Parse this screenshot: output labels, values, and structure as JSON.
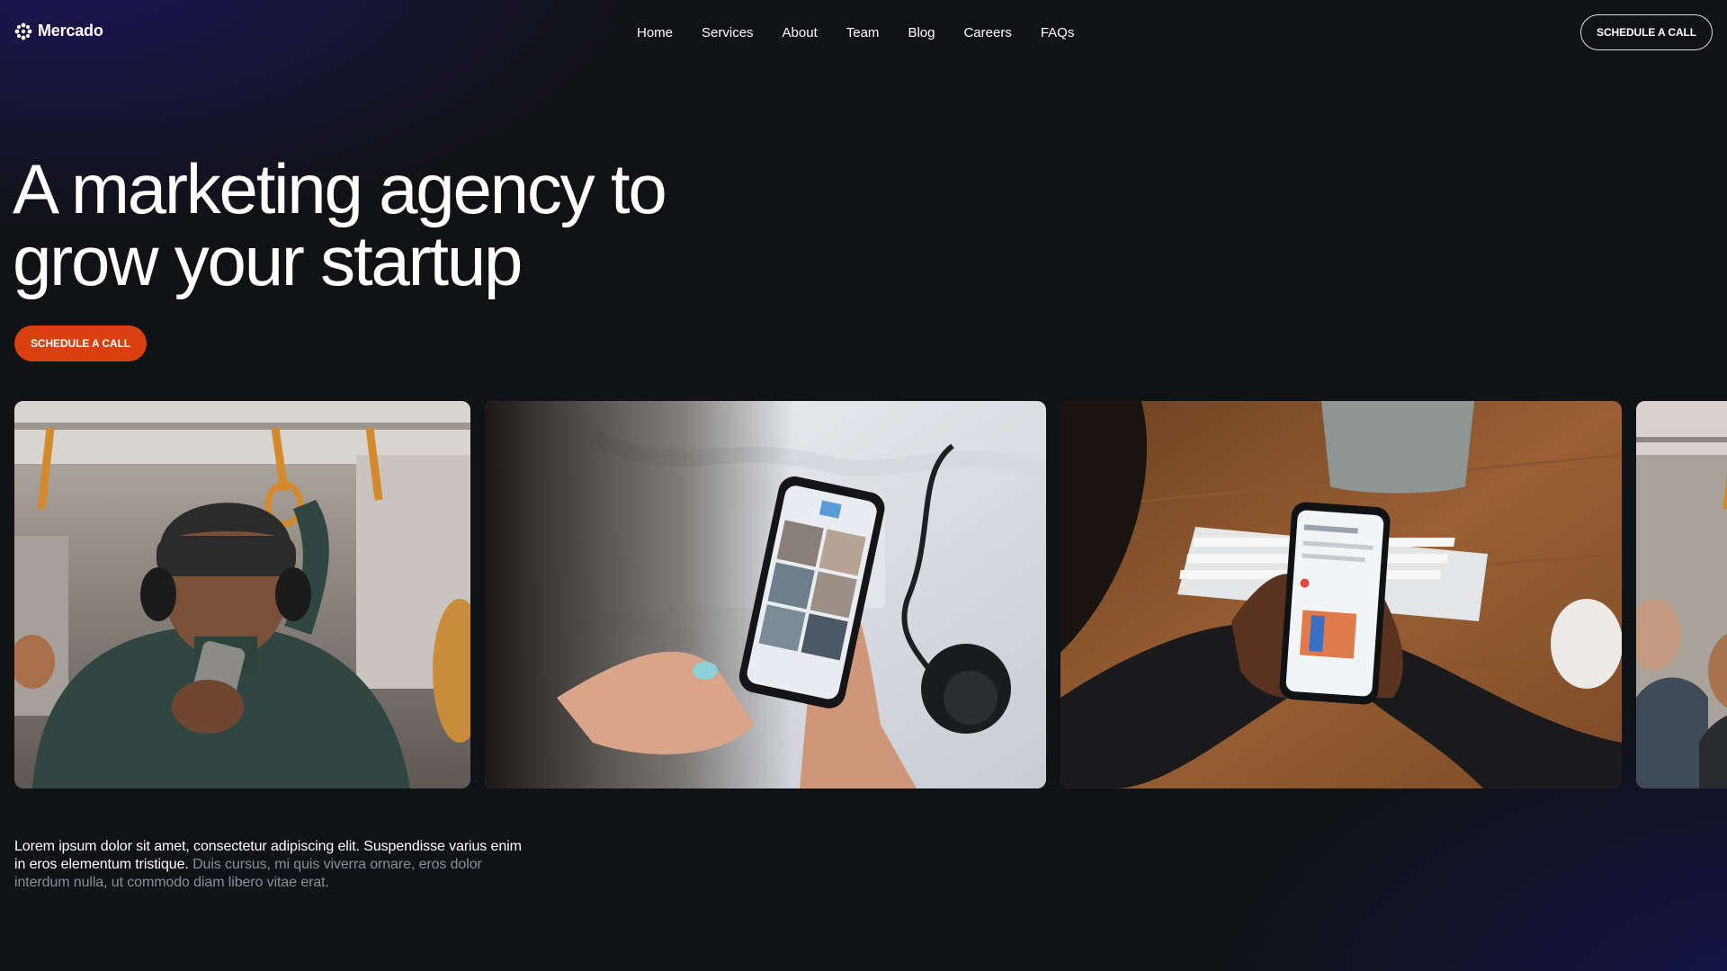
{
  "brand": {
    "name": "Mercado",
    "logo_icon": "flower-icon"
  },
  "nav": {
    "links": [
      "Home",
      "Services",
      "About",
      "Team",
      "Blog",
      "Careers",
      "FAQs"
    ],
    "cta_label": "SCHEDULE A CALL"
  },
  "hero": {
    "title_line1": "A marketing agency to",
    "title_line2": "grow your startup",
    "cta_label": "SCHEDULE A CALL",
    "cta_color": "#d9400f"
  },
  "gallery": {
    "images": [
      "man-with-headphones-on-train-using-phone",
      "hands-scrolling-phone-over-bed",
      "hands-holding-phone-at-desk-with-keyboard",
      "passengers-on-train"
    ]
  },
  "intro": {
    "strong": "Lorem ipsum dolor sit amet, consectetur adipiscing elit. Suspendisse varius enim in eros elementum tristique.",
    "muted": " Duis cursus, mi quis viverra ornare, eros dolor interdum nulla, ut commodo diam libero vitae erat."
  },
  "colors": {
    "background": "#111216",
    "text": "#ffffff",
    "muted_text": "#8b8d98",
    "accent": "#d9400f"
  }
}
